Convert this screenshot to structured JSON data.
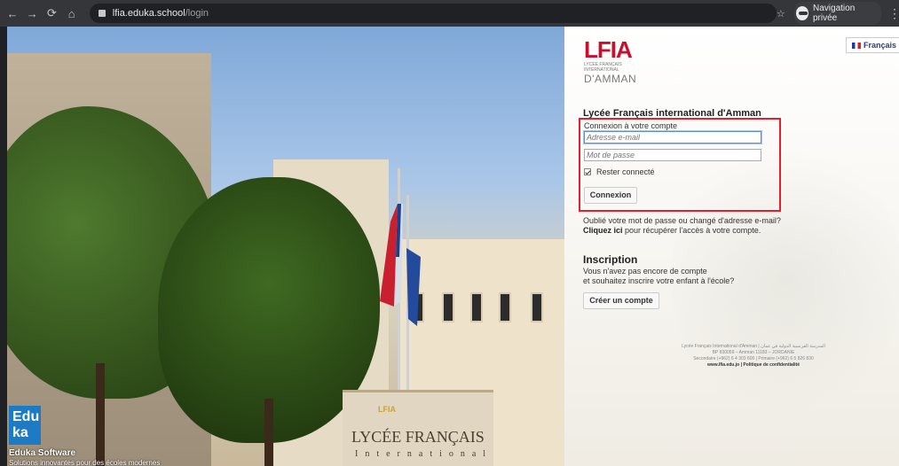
{
  "browser": {
    "url_host": "lfia.eduka.school",
    "url_path": "/login",
    "private_label": "Navigation privée"
  },
  "photo": {
    "sign_logo": "LFIA",
    "sign_title": "LYCÉE FRANÇAIS",
    "sign_subtitle": "International",
    "eduka_badge": "Edu ka",
    "eduka_name": "Eduka Software",
    "eduka_tagline": "Solutions innovantes pour des écoles modernes"
  },
  "panel": {
    "language": "Français",
    "logo_mark": "LFIA",
    "logo_small": "LYCÉE FRANÇAIS INTERNATIONAL",
    "logo_city": "D'AMMAN",
    "school_name": "Lycée Français international d'Amman",
    "login": {
      "subtitle": "Connexion à votre compte",
      "email_placeholder": "Adresse e-mail",
      "password_placeholder": "Mot de passe",
      "remember_label": "Rester connecté",
      "remember_checked": true,
      "submit_label": "Connexion"
    },
    "forgot": {
      "line1": "Oublié votre mot de passe ou changé d'adresse e-mail?",
      "link": "Cliquez ici",
      "line2": " pour récupérer l'accès à votre compte."
    },
    "register": {
      "title": "Inscription",
      "line1": "Vous n'avez pas encore de compte",
      "line2": "et souhaitez inscrire votre enfant à l'école?",
      "button": "Créer un compte"
    },
    "footer": {
      "line1": "Lycée Français International d'Amman | المدرسة الفرنسية الدولية في عمان",
      "line2": "BP 830059 – Amman 11183 – JORDANIE",
      "line3": "Secondaire (+962) 6 4 303 600 | Primaire (+962) 6 5 826 830",
      "website": "www.lfia.edu.jo",
      "privacy": "Politique de confidentialité"
    }
  }
}
